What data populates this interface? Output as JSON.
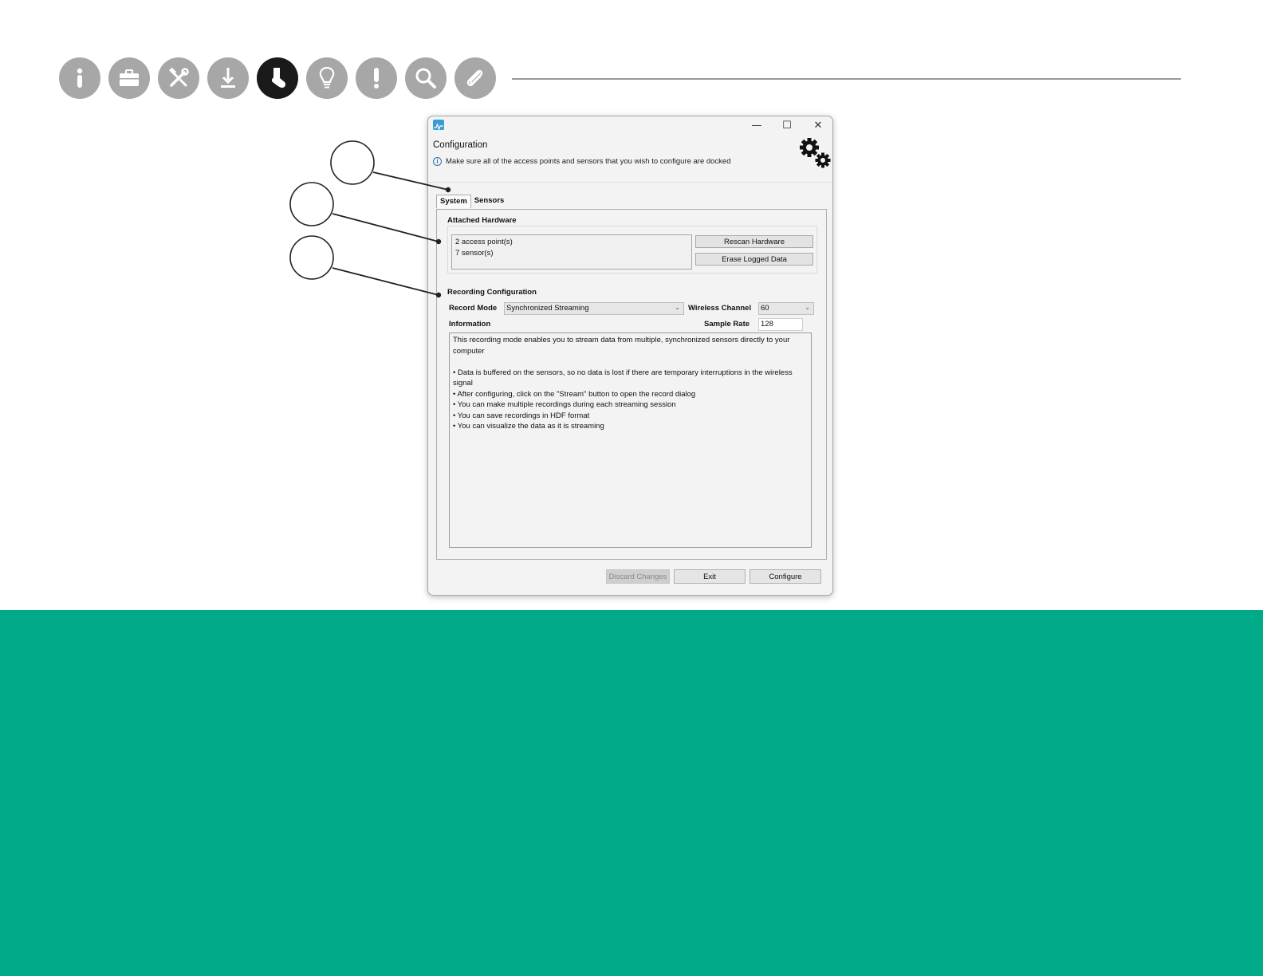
{
  "nav_icons": [
    "info-icon",
    "briefcase-icon",
    "tools-icon",
    "download-icon",
    "sock-icon",
    "lightbulb-icon",
    "exclamation-icon",
    "search-icon",
    "paperclip-icon"
  ],
  "active_nav_icon": "sock-icon",
  "colors": {
    "accent_green": "#00a987",
    "nav_icon_gray": "#a7a7a7",
    "nav_icon_active": "#1a1a1a"
  },
  "window": {
    "title": "Configuration",
    "info_text": "Make sure all of the access points and sensors that you wish to configure are docked",
    "controls": {
      "minimize": "—",
      "maximize": "☐",
      "close": "✕"
    }
  },
  "tabs": [
    {
      "label": "System",
      "active": true
    },
    {
      "label": "Sensors",
      "active": false
    }
  ],
  "attached_hardware": {
    "label": "Attached Hardware",
    "items": [
      "2 access point(s)",
      "7 sensor(s)"
    ],
    "rescan_label": "Rescan Hardware",
    "erase_label": "Erase Logged Data"
  },
  "recording": {
    "label": "Recording Configuration",
    "record_mode_label": "Record Mode",
    "record_mode_value": "Synchronized Streaming",
    "wireless_channel_label": "Wireless Channel",
    "wireless_channel_value": "60",
    "information_label": "Information",
    "sample_rate_label": "Sample Rate",
    "sample_rate_value": "128",
    "info_intro": "This recording mode enables you to stream data from multiple, synchronized sensors directly to your computer",
    "info_bullets": [
      " • Data is buffered on the sensors, so no data is lost if there are temporary interruptions in the wireless signal",
      " • After configuring, click on the \"Stream\" button to open the record dialog",
      " • You can make multiple recordings during each streaming session",
      " • You can save recordings in HDF format",
      " • You can visualize the data as it is streaming"
    ]
  },
  "footer_buttons": {
    "discard_label": "Discard Changes",
    "exit_label": "Exit",
    "configure_label": "Configure"
  }
}
